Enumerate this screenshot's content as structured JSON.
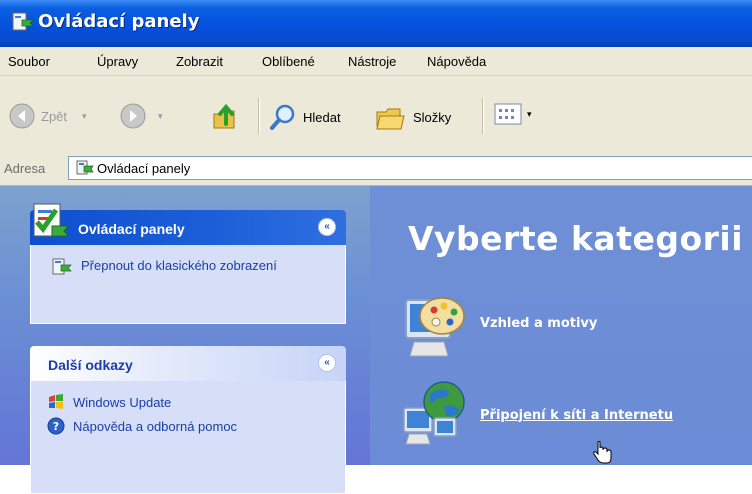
{
  "window": {
    "title": "Ovládací panely"
  },
  "menu": [
    "Soubor",
    "Úpravy",
    "Zobrazit",
    "Oblíbené",
    "Nástroje",
    "Nápověda"
  ],
  "toolbar": {
    "back_label": "Zpět",
    "search_label": "Hledat",
    "folders_label": "Složky"
  },
  "address": {
    "label": "Adresa",
    "value": "Ovládací panely"
  },
  "task_pane": {
    "box1": {
      "title": "Ovládací panely",
      "item": "Přepnout do klasického zobrazení",
      "toggle": "«"
    },
    "box2": {
      "title": "Další odkazy",
      "toggle": "«",
      "links": [
        "Windows Update",
        "Nápověda a odborná pomoc"
      ]
    }
  },
  "main": {
    "heading": "Vyberte kategorii",
    "categories": [
      "Vzhled a motivy",
      "Připojení k síti a Internetu"
    ]
  },
  "colors": {
    "title_blue": "#0551dd",
    "pane_blue": "#6b8bd6",
    "link_blue": "#1a3ea8"
  }
}
